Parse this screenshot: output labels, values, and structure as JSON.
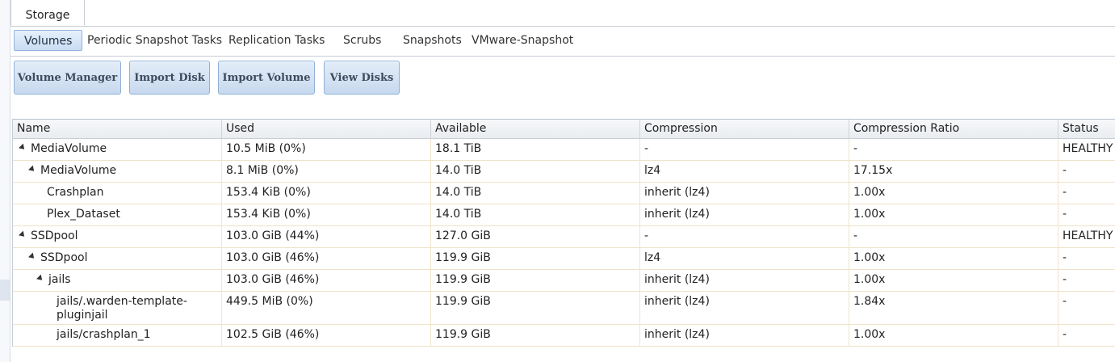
{
  "top_tab": {
    "label": "Storage"
  },
  "subtabs": [
    {
      "label": "Volumes",
      "active": true
    },
    {
      "label": "Periodic Snapshot Tasks",
      "active": false
    },
    {
      "label": "Replication Tasks",
      "active": false
    },
    {
      "label": "Scrubs",
      "active": false
    },
    {
      "label": "Snapshots",
      "active": false
    },
    {
      "label": "VMware-Snapshot",
      "active": false
    }
  ],
  "buttons": {
    "volume_manager": "Volume Manager",
    "import_disk": "Import Disk",
    "import_volume": "Import Volume",
    "view_disks": "View Disks"
  },
  "columns": [
    "Name",
    "Used",
    "Available",
    "Compression",
    "Compression Ratio",
    "Status"
  ],
  "rows": [
    {
      "level": 0,
      "expandable": true,
      "name": "MediaVolume",
      "used": "10.5 MiB (0%)",
      "available": "18.1 TiB",
      "compression": "-",
      "ratio": "-",
      "status": "HEALTHY"
    },
    {
      "level": 1,
      "expandable": true,
      "name": "MediaVolume",
      "used": "8.1 MiB (0%)",
      "available": "14.0 TiB",
      "compression": "lz4",
      "ratio": "17.15x",
      "status": "-"
    },
    {
      "level": 2,
      "expandable": false,
      "name": "Crashplan",
      "used": "153.4 KiB (0%)",
      "available": "14.0 TiB",
      "compression": "inherit (lz4)",
      "ratio": "1.00x",
      "status": "-"
    },
    {
      "level": 2,
      "expandable": false,
      "name": "Plex_Dataset",
      "used": "153.4 KiB (0%)",
      "available": "14.0 TiB",
      "compression": "inherit (lz4)",
      "ratio": "1.00x",
      "status": "-"
    },
    {
      "level": 0,
      "expandable": true,
      "name": "SSDpool",
      "used": "103.0 GiB (44%)",
      "available": "127.0 GiB",
      "compression": "-",
      "ratio": "-",
      "status": "HEALTHY"
    },
    {
      "level": 1,
      "expandable": true,
      "name": "SSDpool",
      "used": "103.0 GiB (46%)",
      "available": "119.9 GiB",
      "compression": "lz4",
      "ratio": "1.00x",
      "status": "-"
    },
    {
      "level": 2,
      "expandable": true,
      "name": "jails",
      "used": "103.0 GiB (46%)",
      "available": "119.9 GiB",
      "compression": "inherit (lz4)",
      "ratio": "1.00x",
      "status": "-"
    },
    {
      "level": 3,
      "expandable": false,
      "name": "jails/.warden-template-pluginjail",
      "used": "449.5 MiB (0%)",
      "available": "119.9 GiB",
      "compression": "inherit (lz4)",
      "ratio": "1.84x",
      "status": "-"
    },
    {
      "level": 3,
      "expandable": false,
      "name": "jails/crashplan_1",
      "used": "102.5 GiB (46%)",
      "available": "119.9 GiB",
      "compression": "inherit (lz4)",
      "ratio": "1.00x",
      "status": "-"
    }
  ]
}
